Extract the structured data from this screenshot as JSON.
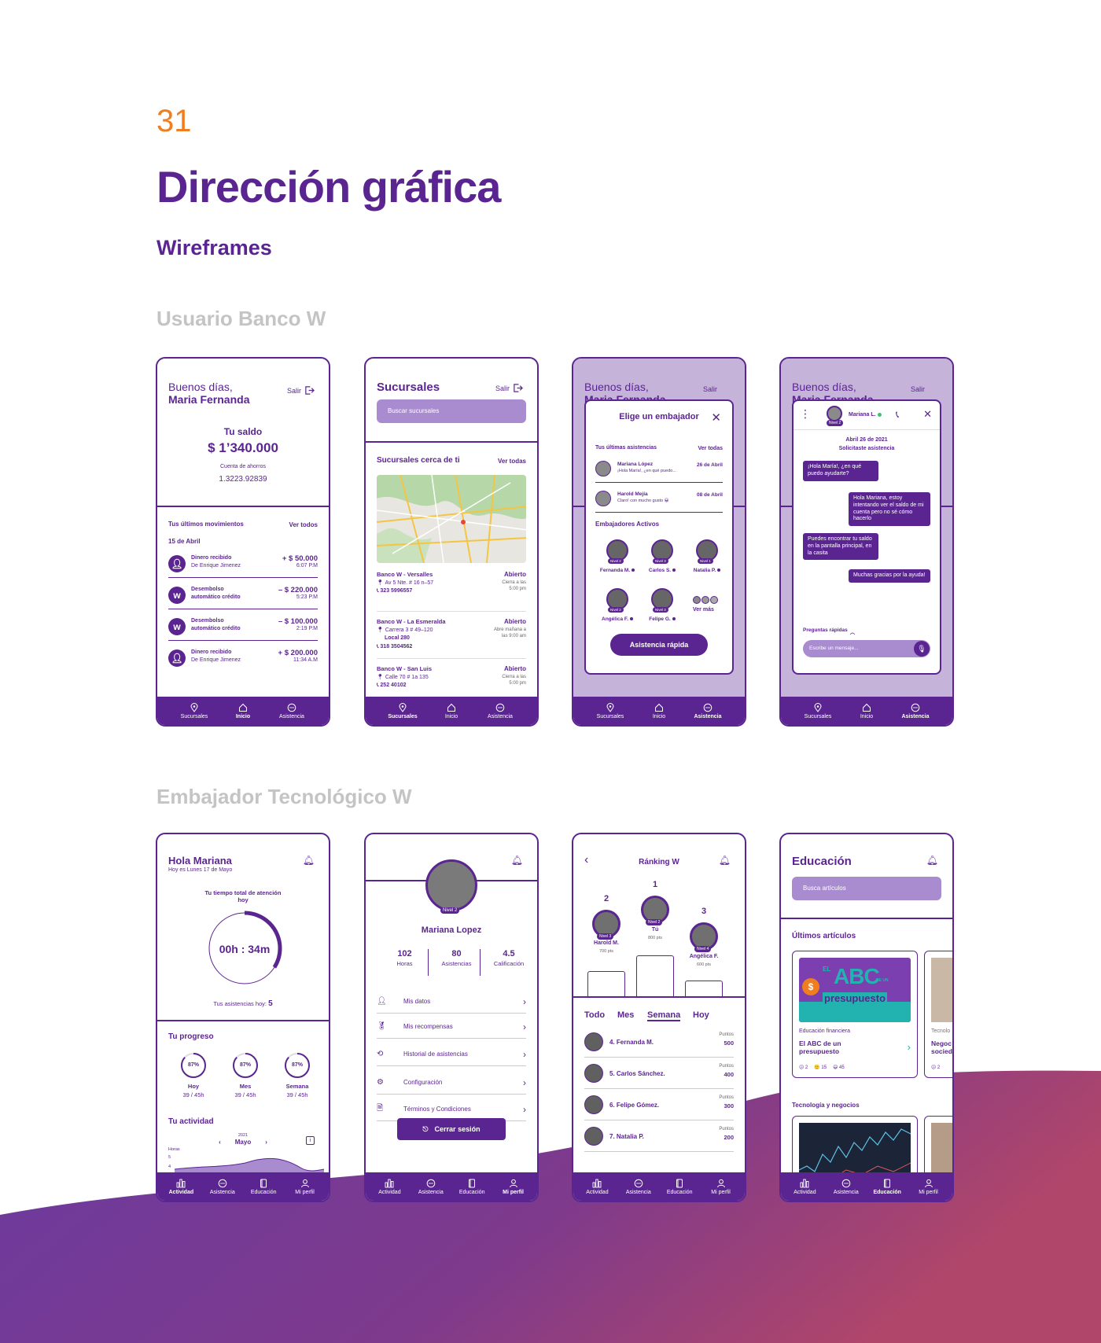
{
  "page": {
    "number": "31",
    "title": "Dirección gráfica",
    "subtitle": "Wireframes",
    "section_user": "Usuario Banco W",
    "section_ambassador": "Embajador Tecnológico W"
  },
  "nav_user": [
    {
      "label": "Sucursales",
      "icon": "pin-icon"
    },
    {
      "label": "Inicio",
      "icon": "home-icon"
    },
    {
      "label": "Asistencia",
      "icon": "chat-icon"
    }
  ],
  "nav_amb": [
    {
      "label": "Actividad",
      "icon": "bars-icon"
    },
    {
      "label": "Asistencia",
      "icon": "chat-icon"
    },
    {
      "label": "Educación",
      "icon": "book-icon"
    },
    {
      "label": "Mi perfil",
      "icon": "user-icon"
    }
  ],
  "s1": {
    "greeting": "Buenos días,",
    "name": "Maria Fernanda",
    "logout": "Salir",
    "balance_label": "Tu saldo",
    "balance": "$ 1’340.000",
    "account_type": "Cuenta de ahorros",
    "account_no": "1.3223.92839",
    "movements_title": "Tus últimos movimientos",
    "see_all": "Ver todos",
    "date": "15 de Abril",
    "movements": [
      {
        "title": "Dinero recibido",
        "desc": "De Enrique Jimenez",
        "amount": "+ $ 50.000",
        "time": "6:07 P.M"
      },
      {
        "title": "Desembolso",
        "desc": "automático crédito",
        "amount": "– $ 220.000",
        "time": "5:23 P.M"
      },
      {
        "title": "Desembolso",
        "desc": "automático crédito",
        "amount": "– $ 100.000",
        "time": "2:19 P.M"
      },
      {
        "title": "Dinero recibido",
        "desc": "De Enrique Jimenez",
        "amount": "+ $ 200.000",
        "time": "11:34 A.M"
      }
    ]
  },
  "s2": {
    "title": "Sucursales",
    "logout": "Salir",
    "search_placeholder": "Buscar sucursales",
    "near": "Sucursales cerca de ti",
    "see_all": "Ver todas",
    "branches": [
      {
        "name": "Banco W - Versalles",
        "status": "Abierto",
        "addr": "Av 5 Nte. # 16 n–57",
        "addr2": "",
        "phone": "323 5996557",
        "hours": "Cierra a las",
        "hours2": "5:00 pm"
      },
      {
        "name": "Banco W - La Esmeralda",
        "status": "Abierto",
        "addr": "Carrera 3 # 49–120",
        "addr2": "Local 280",
        "phone": "318 3504562",
        "hours": "Abre mañana a",
        "hours2": "las 9:00 am"
      },
      {
        "name": "Banco W - San Luis",
        "status": "Abierto",
        "addr": "Calle 70 # 1a 135",
        "addr2": "",
        "phone": "252 40102",
        "hours": "Cierra a las",
        "hours2": "5:00 pm"
      }
    ]
  },
  "s3": {
    "greeting": "Buenos días,",
    "name": "Maria Fernanda",
    "logout": "Salir",
    "modal_title": "Elige un embajador",
    "last": "Tus últimas asistencias",
    "see_all": "Ver todas",
    "history": [
      {
        "name": "Mariana López",
        "msg": "¡Hola María!, ¿en qué puedo...",
        "date": "26 de Abril"
      },
      {
        "name": "Harold Mejía",
        "msg": "Claro! con mucho gusto 😀",
        "date": "08 de Abril"
      }
    ],
    "active": "Embajadores Activos",
    "ambassadors": [
      {
        "name": "Fernanda M.",
        "level": "Nivel 2"
      },
      {
        "name": "Carlos S.",
        "level": "Nivel 3"
      },
      {
        "name": "Natalia P.",
        "level": "Nivel 1"
      },
      {
        "name": "Angélica F.",
        "level": "Nivel 2"
      },
      {
        "name": "Felipe G.",
        "level": "Nivel 3"
      }
    ],
    "more": "Ver más",
    "quick": "Asistencia rápida"
  },
  "s4": {
    "greeting": "Buenos días,",
    "name": "Maria Fernanda",
    "logout": "Salir",
    "contact": "Mariana L.",
    "contact_level": "Nivel 2",
    "date": "Abril 26 de 2021",
    "note": "Solicitaste asistencia",
    "messages": [
      {
        "text": "¡Hola María!, ¿en qué puedo ayudarte?",
        "side": "left"
      },
      {
        "text": "Hola Mariana, estoy intentando ver el saldo de mi cuenta pero no sé cómo hacerlo",
        "side": "right"
      },
      {
        "text": "Puedes encontrar tu saldo en la pantalla principal, en la casita",
        "side": "left"
      },
      {
        "text": "Muchas gracias por la ayuda!",
        "side": "right"
      }
    ],
    "quick_q": "Preguntas rápidas",
    "input_placeholder": "Escribe un mensaje..."
  },
  "s5": {
    "greeting": "Hola Mariana",
    "date": "Hoy es Lunes 17 de Mayo",
    "time_label": "Tu tiempo total de atención hoy",
    "time": "00h : 34m",
    "time_progress": 0.34,
    "assist_label": "Tus asistencias hoy:",
    "assist_count": "5",
    "progress_title": "Tu progreso",
    "progress": [
      {
        "pct": "87%",
        "label": "Hoy",
        "hours": "39 / 45h",
        "value": 0.87
      },
      {
        "pct": "87%",
        "label": "Mes",
        "hours": "39 / 45h",
        "value": 0.87
      },
      {
        "pct": "87%",
        "label": "Semana",
        "hours": "39 / 45h",
        "value": 0.87
      }
    ],
    "activity_title": "Tu actividad",
    "year": "2021",
    "month": "Mayo",
    "hours_label": "Horas",
    "y_ticks": [
      "5",
      "4"
    ]
  },
  "s6": {
    "name": "Mariana Lopez",
    "level": "Nivel 2",
    "stats": [
      {
        "value": "102",
        "label": "Horas"
      },
      {
        "value": "80",
        "label": "Asistencias"
      },
      {
        "value": "4.5",
        "label": "Calificación"
      }
    ],
    "menu": [
      {
        "label": "Mis datos",
        "icon": "user-icon"
      },
      {
        "label": "Mis recompensas",
        "icon": "medal-icon"
      },
      {
        "label": "Historial de asistencias",
        "icon": "history-icon"
      },
      {
        "label": "Configuración",
        "icon": "gear-icon"
      },
      {
        "label": "Términos y Condiciones",
        "icon": "document-icon"
      }
    ],
    "logout": "Cerrar sesión"
  },
  "s7": {
    "title": "Ránking W",
    "podium": [
      {
        "rank": "2",
        "name": "Harold M.",
        "pts": "700 pts",
        "level": "Nivel 3"
      },
      {
        "rank": "1",
        "name": "Tú",
        "pts": "800 pts",
        "level": "Nivel 2"
      },
      {
        "rank": "3",
        "name": "Angélica F.",
        "pts": "600 pts",
        "level": "Nivel 4"
      }
    ],
    "tabs": [
      "Todo",
      "Mes",
      "Semana",
      "Hoy"
    ],
    "list": [
      {
        "name": "4. Fernanda M.",
        "label": "Puntos",
        "pts": "500"
      },
      {
        "name": "5. Carlos Sánchez.",
        "label": "Puntos",
        "pts": "400"
      },
      {
        "name": "6. Felipe Gómez.",
        "label": "Puntos",
        "pts": "300"
      },
      {
        "name": "7. Natalia P.",
        "label": "Puntos",
        "pts": "200"
      }
    ]
  },
  "s8": {
    "title": "Educación",
    "search_placeholder": "Busca artículos",
    "latest": "Últimos artículos",
    "card": {
      "cat": "Educación financiera",
      "title": "El ABC de un presupuesto",
      "banner_el": "EL",
      "banner_abc": "ABC",
      "banner_de": "DE UN",
      "banner_presu": "presupuesto",
      "r1": "2",
      "r2": "15",
      "r3": "45"
    },
    "card2": {
      "cat": "Tecnolo",
      "title": "Negoc",
      "title2": "socied",
      "r1": "2"
    },
    "tech": "Tecnología y negocios"
  },
  "colors": {
    "primary": "#5b2591",
    "accent": "#f07d1e",
    "light": "#a98bd0",
    "teal": "#22b3b0",
    "gray": "#c4c4c4"
  }
}
